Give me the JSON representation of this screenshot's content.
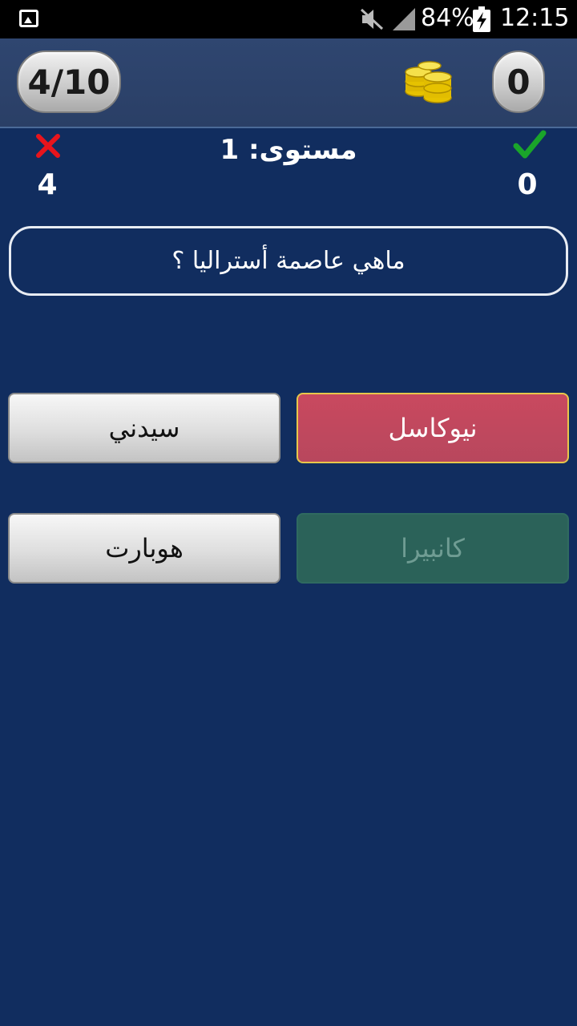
{
  "status_bar": {
    "battery_percent": "84%",
    "time": "12:15",
    "icons": [
      "gallery-icon",
      "mute-icon",
      "signal-icon",
      "battery-charging-icon"
    ]
  },
  "header": {
    "progress": "4/10",
    "coins": "0",
    "coins_icon": "gold-coins-icon"
  },
  "score": {
    "wrong_count": "4",
    "correct_count": "0",
    "level_text": "مستوى: 1",
    "wrong_color": "#e8141c",
    "correct_color": "#1aa52a"
  },
  "question": {
    "text": "ماهي عاصمة أستراليا ؟"
  },
  "answers": [
    {
      "label": "نيوكاسل",
      "state": "wrong"
    },
    {
      "label": "سيدني",
      "state": "normal"
    },
    {
      "label": "كانبيرا",
      "state": "correct"
    },
    {
      "label": "هوبارت",
      "state": "normal"
    }
  ],
  "colors": {
    "background": "#112d5f",
    "header": "#2c4269",
    "wrong_answer": "#c04a5e",
    "correct_answer": "#2b6259"
  }
}
